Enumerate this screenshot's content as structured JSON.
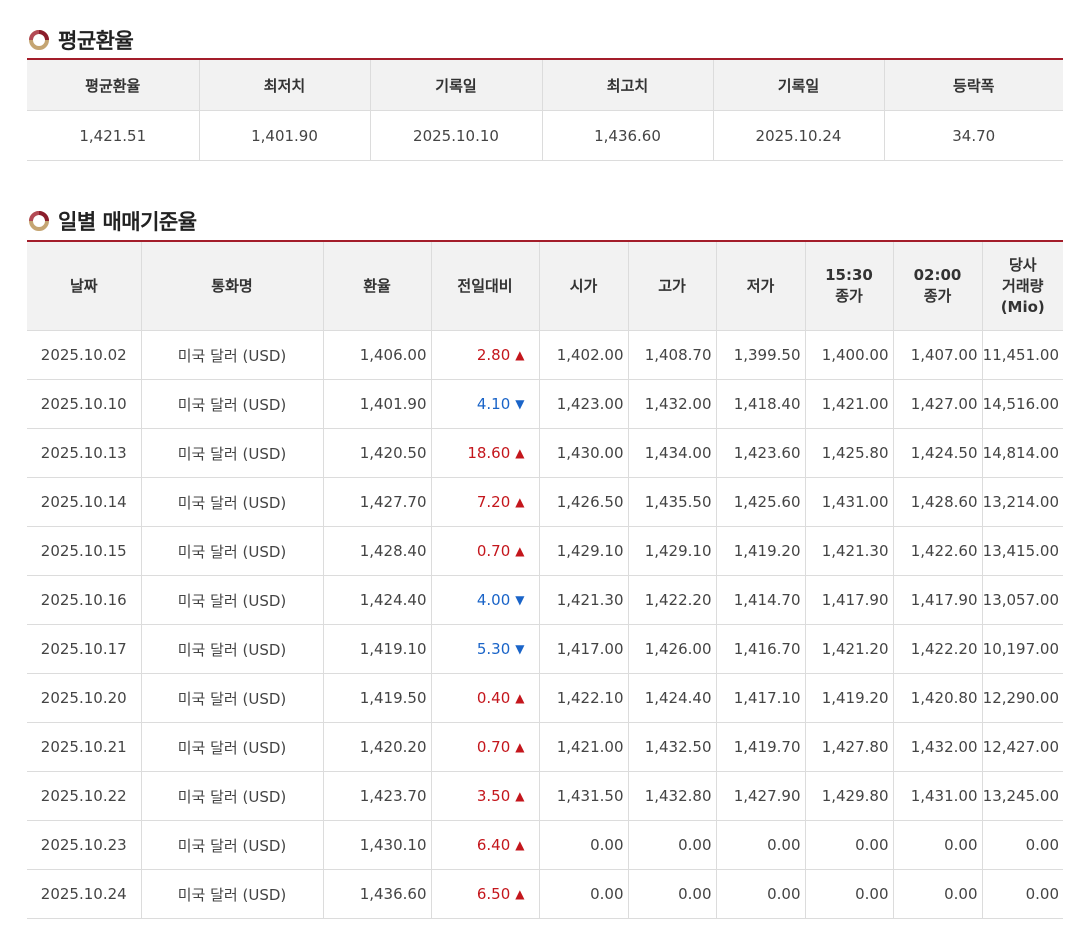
{
  "summary": {
    "title": "평균환율",
    "headers": [
      "평균환율",
      "최저치",
      "기록일",
      "최고치",
      "기록일",
      "등락폭"
    ],
    "values": [
      "1,421.51",
      "1,401.90",
      "2025.10.10",
      "1,436.60",
      "2025.10.24",
      "34.70"
    ]
  },
  "daily": {
    "title": "일별 매매기준율",
    "headers": {
      "date": "날짜",
      "currency": "통화명",
      "rate": "환율",
      "change": "전일대비",
      "open": "시가",
      "high": "고가",
      "low": "저가",
      "close_1530_time": "15:30",
      "close_1530_label": "종가",
      "close_0200_time": "02:00",
      "close_0200_label": "종가",
      "volume_line1": "당사",
      "volume_line2": "거래량",
      "volume_line3": "(Mio)"
    },
    "rows": [
      {
        "date": "2025.10.02",
        "currency": "미국 달러 (USD)",
        "rate": "1,406.00",
        "change": "2.80",
        "direction": "up",
        "open": "1,402.00",
        "high": "1,408.70",
        "low": "1,399.50",
        "close_1530": "1,400.00",
        "close_0200": "1,407.00",
        "volume": "11,451.00"
      },
      {
        "date": "2025.10.10",
        "currency": "미국 달러 (USD)",
        "rate": "1,401.90",
        "change": "4.10",
        "direction": "down",
        "open": "1,423.00",
        "high": "1,432.00",
        "low": "1,418.40",
        "close_1530": "1,421.00",
        "close_0200": "1,427.00",
        "volume": "14,516.00"
      },
      {
        "date": "2025.10.13",
        "currency": "미국 달러 (USD)",
        "rate": "1,420.50",
        "change": "18.60",
        "direction": "up",
        "open": "1,430.00",
        "high": "1,434.00",
        "low": "1,423.60",
        "close_1530": "1,425.80",
        "close_0200": "1,424.50",
        "volume": "14,814.00"
      },
      {
        "date": "2025.10.14",
        "currency": "미국 달러 (USD)",
        "rate": "1,427.70",
        "change": "7.20",
        "direction": "up",
        "open": "1,426.50",
        "high": "1,435.50",
        "low": "1,425.60",
        "close_1530": "1,431.00",
        "close_0200": "1,428.60",
        "volume": "13,214.00"
      },
      {
        "date": "2025.10.15",
        "currency": "미국 달러 (USD)",
        "rate": "1,428.40",
        "change": "0.70",
        "direction": "up",
        "open": "1,429.10",
        "high": "1,429.10",
        "low": "1,419.20",
        "close_1530": "1,421.30",
        "close_0200": "1,422.60",
        "volume": "13,415.00"
      },
      {
        "date": "2025.10.16",
        "currency": "미국 달러 (USD)",
        "rate": "1,424.40",
        "change": "4.00",
        "direction": "down",
        "open": "1,421.30",
        "high": "1,422.20",
        "low": "1,414.70",
        "close_1530": "1,417.90",
        "close_0200": "1,417.90",
        "volume": "13,057.00"
      },
      {
        "date": "2025.10.17",
        "currency": "미국 달러 (USD)",
        "rate": "1,419.10",
        "change": "5.30",
        "direction": "down",
        "open": "1,417.00",
        "high": "1,426.00",
        "low": "1,416.70",
        "close_1530": "1,421.20",
        "close_0200": "1,422.20",
        "volume": "10,197.00"
      },
      {
        "date": "2025.10.20",
        "currency": "미국 달러 (USD)",
        "rate": "1,419.50",
        "change": "0.40",
        "direction": "up",
        "open": "1,422.10",
        "high": "1,424.40",
        "low": "1,417.10",
        "close_1530": "1,419.20",
        "close_0200": "1,420.80",
        "volume": "12,290.00"
      },
      {
        "date": "2025.10.21",
        "currency": "미국 달러 (USD)",
        "rate": "1,420.20",
        "change": "0.70",
        "direction": "up",
        "open": "1,421.00",
        "high": "1,432.50",
        "low": "1,419.70",
        "close_1530": "1,427.80",
        "close_0200": "1,432.00",
        "volume": "12,427.00"
      },
      {
        "date": "2025.10.22",
        "currency": "미국 달러 (USD)",
        "rate": "1,423.70",
        "change": "3.50",
        "direction": "up",
        "open": "1,431.50",
        "high": "1,432.80",
        "low": "1,427.90",
        "close_1530": "1,429.80",
        "close_0200": "1,431.00",
        "volume": "13,245.00"
      },
      {
        "date": "2025.10.23",
        "currency": "미국 달러 (USD)",
        "rate": "1,430.10",
        "change": "6.40",
        "direction": "up",
        "open": "0.00",
        "high": "0.00",
        "low": "0.00",
        "close_1530": "0.00",
        "close_0200": "0.00",
        "volume": "0.00"
      },
      {
        "date": "2025.10.24",
        "currency": "미국 달러 (USD)",
        "rate": "1,436.60",
        "change": "6.50",
        "direction": "up",
        "open": "0.00",
        "high": "0.00",
        "low": "0.00",
        "close_1530": "0.00",
        "close_0200": "0.00",
        "volume": "0.00"
      }
    ]
  },
  "icons": {
    "up": "triangle-up-icon",
    "down": "triangle-down-icon",
    "section": "section-ring-icon"
  },
  "colors": {
    "accent_line": "#a31d2a",
    "up": "#c4161c",
    "down": "#1a64c8",
    "header_bg": "#f2f2f2"
  }
}
